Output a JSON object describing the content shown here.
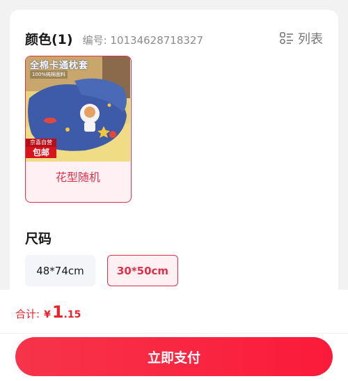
{
  "color_section": {
    "title": "颜色(1)",
    "sku": "编号: 10134628718327",
    "list_toggle_label": "列表",
    "options": [
      {
        "label": "花型随机",
        "selected": true,
        "thumb_title": "全棉卡通枕套",
        "thumb_subtitle": "100%纯棉面料",
        "promo_line1": "京喜自营",
        "promo_line2": "包邮"
      }
    ]
  },
  "size_section": {
    "title": "尺码",
    "options": [
      {
        "label": "48*74cm",
        "selected": false
      },
      {
        "label": "30*50cm",
        "selected": true
      }
    ]
  },
  "footer": {
    "total_label": "合计:",
    "currency": "¥",
    "amount_int": "1",
    "amount_dec": ".15",
    "pay_label": "立即支付"
  },
  "colors": {
    "accent": "#e0304a",
    "price": "#e8232c",
    "pay_button": "#f6344a"
  }
}
